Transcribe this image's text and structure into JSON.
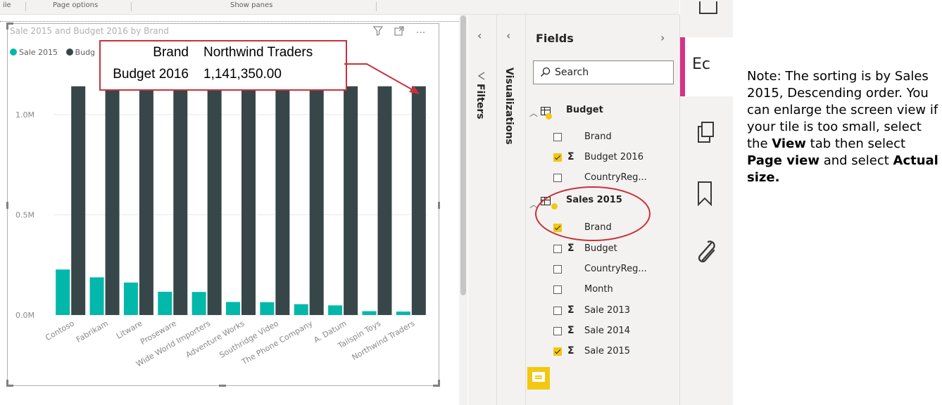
{
  "ribbon": {
    "labels": [
      "ile",
      "Page options",
      "Show panes"
    ]
  },
  "visual": {
    "title": "Sale 2015 and Budget 2016 by Brand",
    "legend": [
      {
        "label": "Sale 2015",
        "color": "#01b8aa"
      },
      {
        "label": "Budg",
        "color": "#374649"
      }
    ],
    "icons": [
      "filter-icon",
      "focus-mode-icon",
      "more-options-icon"
    ]
  },
  "tooltip": {
    "rows": [
      {
        "key": "Brand",
        "value": "Northwind Traders"
      },
      {
        "key": "Budget 2016",
        "value": "1,141,350.00"
      }
    ]
  },
  "chart_data": {
    "type": "bar",
    "title": "Sale 2015 and Budget 2016 by Brand",
    "categories": [
      "Contoso",
      "Fabrikam",
      "Litware",
      "Proseware",
      "Wide World Importers",
      "Adventure Works",
      "Southridge Video",
      "The Phone Company",
      "A. Datum",
      "Tailspin Toys",
      "Northwind Traders"
    ],
    "series": [
      {
        "name": "Sale 2015",
        "color": "#01b8aa",
        "values": [
          227000,
          188000,
          162000,
          116000,
          115000,
          65000,
          64000,
          54000,
          48000,
          19000,
          17000
        ]
      },
      {
        "name": "Budget 2016",
        "color": "#374649",
        "values": [
          1141350,
          1141350,
          1141350,
          1141350,
          1141350,
          1141350,
          1141350,
          1141350,
          1141350,
          1141350,
          1141350
        ]
      }
    ],
    "yticks": [
      "0.0M",
      "0.5M",
      "1.0M"
    ],
    "ylim": [
      0,
      1250000
    ],
    "grid": true,
    "legend_position": "top-left"
  },
  "panes": {
    "filters": "Filters",
    "visualizations": "Visualizations"
  },
  "fields": {
    "title": "Fields",
    "search_placeholder": "Search",
    "tables": [
      {
        "name": "Budget",
        "fields": [
          {
            "label": "Brand",
            "checked": false,
            "sigma": false
          },
          {
            "label": "Budget 2016",
            "checked": true,
            "sigma": true
          },
          {
            "label": "CountryReg...",
            "checked": false,
            "sigma": false
          }
        ]
      },
      {
        "name": "Sales 2015",
        "fields": [
          {
            "label": "Brand",
            "checked": true,
            "sigma": false
          },
          {
            "label": "Budget",
            "checked": false,
            "sigma": true
          },
          {
            "label": "CountryReg...",
            "checked": false,
            "sigma": false
          },
          {
            "label": "Month",
            "checked": false,
            "sigma": false
          },
          {
            "label": "Sale 2013",
            "checked": false,
            "sigma": true
          },
          {
            "label": "Sale 2014",
            "checked": false,
            "sigma": true
          },
          {
            "label": "Sale 2015",
            "checked": true,
            "sigma": true
          }
        ]
      }
    ]
  },
  "right_panel": {
    "edit_label": "Ec",
    "accent": "#d63384"
  },
  "note": {
    "line1": "Note:  The sorting is by Sales 2015, Descending order. You can enlarge the screen view if your tile is too small, select the",
    "bold1": "View",
    "mid1": "tab then select",
    "bold2": "Page view",
    "mid2": "and select",
    "bold3": "Actual size."
  },
  "colors": {
    "highlight": "#c9323b",
    "yellow": "#f2c811"
  }
}
